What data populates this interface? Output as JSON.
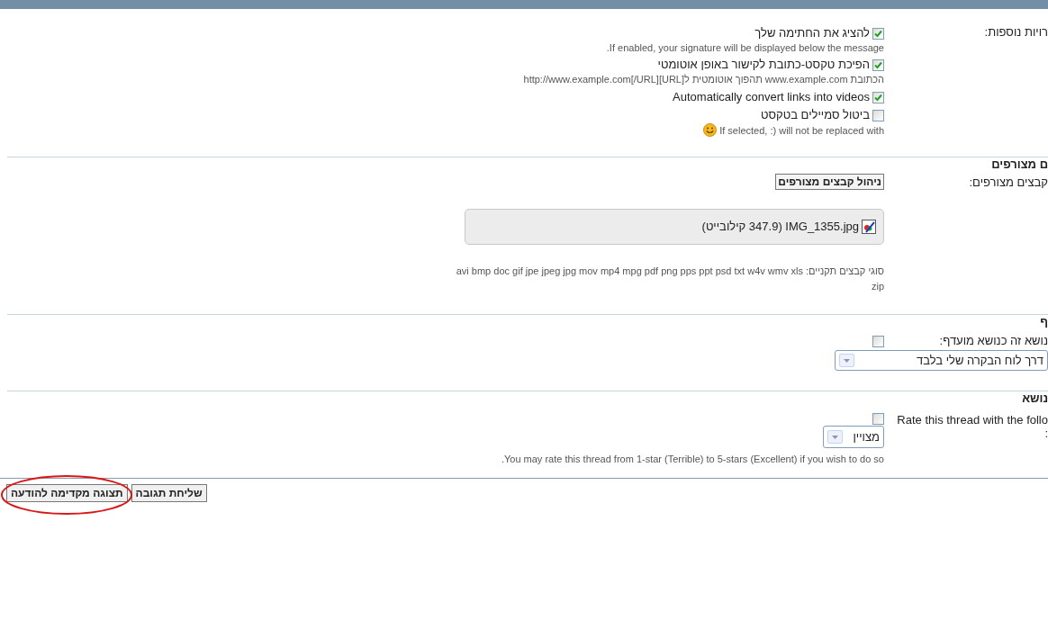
{
  "options": {
    "label": "רויות נוספות:",
    "items": [
      {
        "label": "להציג את החתימה שלך",
        "hint": "If enabled, your signature will be displayed below the message.",
        "checked": true,
        "hint_icon": false
      },
      {
        "label": "הפיכת טקסט-כתובת לקישור באופן אוטומטי",
        "hint": "הכתובת www.example.com תהפוך אוטומטית ל[URL]http://www.example.com[/URL]",
        "checked": true,
        "hint_icon": false
      },
      {
        "label": "Automatically convert links into videos",
        "checked": true,
        "hint_icon": false
      },
      {
        "label": "ביטול סמיילים בטקסט",
        "hint": "If selected, :) will not be replaced with",
        "checked": false,
        "hint_icon": true
      }
    ]
  },
  "attachments": {
    "heading": "ם מצורפים",
    "label": "קבצים מצורפים:",
    "manage_button": "ניהול קבצים מצורפים",
    "files": [
      {
        "name": "IMG_1355.jpg (347.9 קילובייט)"
      }
    ],
    "types_label": "סוגי קבצים תקניים:",
    "types": "avi bmp doc gif jpe jpeg jpg mov mp4 mpg pdf png pps ppt psd txt w4v wmv xls zip"
  },
  "subscription": {
    "heading": "ף",
    "label": "נושא זה כנושא מועדף:",
    "checked": false,
    "select_value": "דרך לוח הבקרה שלי בלבד"
  },
  "rating": {
    "heading": "נושא",
    "label_lines": [
      "Rate this thread with the follo",
      ":"
    ],
    "checked": false,
    "select_value": "מצויין",
    "hint": "You may rate this thread from 1-star (Terrible) to 5-stars (Excellent) if you wish to do so."
  },
  "buttons": [
    {
      "label": "שליחת תגובה",
      "highlighted": false
    },
    {
      "label": "תצוגה מקדימה להודעה",
      "highlighted": true
    }
  ]
}
